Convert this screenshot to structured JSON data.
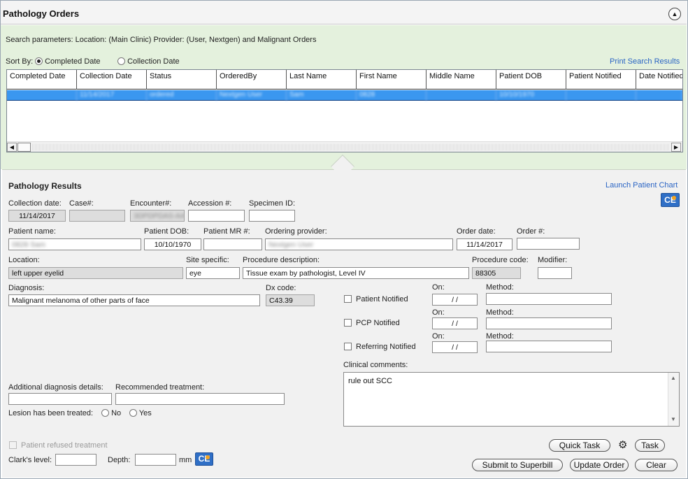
{
  "window": {
    "title": "Pathology Orders"
  },
  "search": {
    "params": "Search parameters: Location: (Main Clinic) Provider: (User, Nextgen) and Malignant Orders",
    "sort_by_label": "Sort By:",
    "sort_options": [
      "Completed Date",
      "Collection Date"
    ],
    "sort_selected": "Completed Date",
    "print_link": "Print Search Results"
  },
  "grid": {
    "columns": [
      "Completed Date",
      "Collection Date",
      "Status",
      "OrderedBy",
      "Last Name",
      "First Name",
      "Middle Name",
      "Patient DOB",
      "Patient Notified",
      "Date Notified"
    ],
    "rows": [
      [
        "",
        "11/14/2017",
        "ordered",
        "Nextgen User",
        "Sam",
        "0828",
        "",
        "10/10/1970",
        "",
        ""
      ]
    ],
    "scroll_left": "◀",
    "scroll_right": "▶"
  },
  "results": {
    "heading": "Pathology Results",
    "launch_link": "Launch Patient Chart",
    "collection_date_label": "Collection date:",
    "collection_date": "11/14/2017",
    "case_label": "Case#:",
    "case_value": "",
    "encounter_label": "Encounter#:",
    "encounter_value": "3DPDPDAS-AA",
    "accession_label": "Accession #:",
    "accession_value": "",
    "specimen_label": "Specimen ID:",
    "specimen_value": "",
    "patient_name_label": "Patient name:",
    "patient_name": "0828 Sam",
    "patient_dob_label": "Patient DOB:",
    "patient_dob": "10/10/1970",
    "patient_mr_label": "Patient MR #:",
    "patient_mr": "",
    "ordering_provider_label": "Ordering provider:",
    "ordering_provider": "Nextgen User",
    "order_date_label": "Order date:",
    "order_date": "11/14/2017",
    "order_num_label": "Order #:",
    "order_num": "",
    "location_label": "Location:",
    "location": "left upper  eyelid",
    "site_label": "Site specific:",
    "site": "eye",
    "proc_desc_label": "Procedure description:",
    "proc_desc": "Tissue exam by pathologist, Level IV",
    "proc_code_label": "Procedure code:",
    "proc_code": "88305",
    "modifier_label": "Modifier:",
    "modifier": "",
    "diagnosis_label": "Diagnosis:",
    "diagnosis": "Malignant melanoma of other parts of face",
    "dx_code_label": "Dx code:",
    "dx_code": "C43.39",
    "on_label": "On:",
    "method_label": "Method:",
    "notify": [
      {
        "label": "Patient Notified",
        "date": " /  /",
        "method": ""
      },
      {
        "label": "PCP Notified",
        "date": " /  /",
        "method": ""
      },
      {
        "label": "Referring Notified",
        "date": " /  /",
        "method": ""
      }
    ],
    "clinical_comments_label": "Clinical comments:",
    "clinical_comments": "rule out SCC",
    "add_dx_label": "Additional diagnosis details:",
    "add_dx": "",
    "rec_treatment_label": "Recommended treatment:",
    "rec_treatment": "",
    "lesion_label": "Lesion has been treated:",
    "lesion_options": [
      "No",
      "Yes"
    ],
    "refused_label": "Patient refused treatment",
    "clarks_label": "Clark's level:",
    "clarks": "",
    "depth_label": "Depth:",
    "depth": "",
    "depth_unit": "mm",
    "ce_icon": "CE"
  },
  "buttons": {
    "quick_task": "Quick Task",
    "task": "Task",
    "submit": "Submit to Superbill",
    "update": "Update Order",
    "clear": "Clear"
  },
  "icons": {
    "collapse": "chevron-up-icon",
    "gear": "gear-icon",
    "ce": "clinical-evidence-icon"
  }
}
